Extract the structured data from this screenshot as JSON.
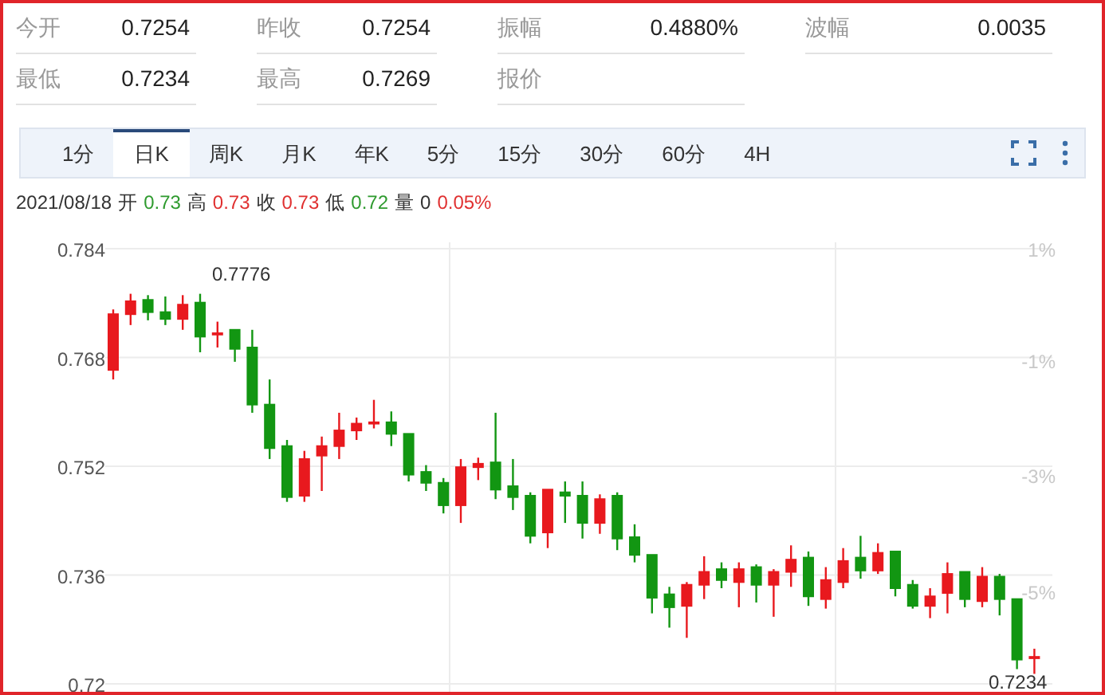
{
  "stats": [
    {
      "label": "今开",
      "value": "0.7254"
    },
    {
      "label": "昨收",
      "value": "0.7254"
    },
    {
      "label": "振幅",
      "value": "0.4880%"
    },
    {
      "label": "波幅",
      "value": "0.0035"
    },
    {
      "label": "最低",
      "value": "0.7234"
    },
    {
      "label": "最高",
      "value": "0.7269"
    },
    {
      "label": "报价"
    }
  ],
  "tabs": [
    {
      "label": "1分",
      "selected": false
    },
    {
      "label": "日K",
      "selected": true
    },
    {
      "label": "周K",
      "selected": false
    },
    {
      "label": "月K",
      "selected": false
    },
    {
      "label": "年K",
      "selected": false
    },
    {
      "label": "5分",
      "selected": false
    },
    {
      "label": "15分",
      "selected": false
    },
    {
      "label": "30分",
      "selected": false
    },
    {
      "label": "60分",
      "selected": false
    },
    {
      "label": "4H",
      "selected": false
    }
  ],
  "info": {
    "date": "2021/08/18",
    "items": [
      {
        "label": "开",
        "value": "0.73",
        "color": "#2e9a2e"
      },
      {
        "label": "高",
        "value": "0.73",
        "color": "#e03030"
      },
      {
        "label": "收",
        "value": "0.73",
        "color": "#e03030"
      },
      {
        "label": "低",
        "value": "0.72",
        "color": "#2e9a2e"
      },
      {
        "label": "量",
        "value": "0",
        "color": "#333333"
      }
    ],
    "change": "0.05%"
  },
  "chart": {
    "percent_labels": [
      "1%",
      "-1%",
      "-3%",
      "-5%"
    ],
    "high_label": "0.7776",
    "low_label": "0.7234",
    "chart_data": {
      "type": "candlestick",
      "grid": true,
      "ylim": [
        0.72,
        0.784
      ],
      "yticks": [
        0.784,
        0.768,
        0.752,
        0.736,
        0.72
      ],
      "ohlc": [
        [
          0.7664,
          0.7753,
          0.765,
          0.7746
        ],
        [
          0.7746,
          0.7776,
          0.773,
          0.7765
        ],
        [
          0.7767,
          0.7774,
          0.7737,
          0.7749
        ],
        [
          0.7749,
          0.7772,
          0.773,
          0.7739
        ],
        [
          0.7739,
          0.7774,
          0.7723,
          0.776
        ],
        [
          0.7763,
          0.7776,
          0.769,
          0.7713
        ],
        [
          0.7716,
          0.7735,
          0.7697,
          0.7718
        ],
        [
          0.7723,
          0.7723,
          0.7676,
          0.7695
        ],
        [
          0.7697,
          0.7723,
          0.7601,
          0.7613
        ],
        [
          0.7613,
          0.765,
          0.7533,
          0.7549
        ],
        [
          0.7552,
          0.7561,
          0.747,
          0.7477
        ],
        [
          0.7479,
          0.7545,
          0.747,
          0.7533
        ],
        [
          0.7538,
          0.7566,
          0.7486,
          0.7552
        ],
        [
          0.7552,
          0.7601,
          0.7533,
          0.7575
        ],
        [
          0.7575,
          0.7594,
          0.7561,
          0.7585
        ],
        [
          0.7585,
          0.762,
          0.7578,
          0.7587
        ],
        [
          0.7587,
          0.7603,
          0.7552,
          0.757
        ],
        [
          0.757,
          0.757,
          0.75,
          0.751
        ],
        [
          0.7514,
          0.7524,
          0.7486,
          0.7498
        ],
        [
          0.7498,
          0.7505,
          0.7453,
          0.7465
        ],
        [
          0.7465,
          0.7533,
          0.7439,
          0.7521
        ],
        [
          0.7521,
          0.7535,
          0.7502,
          0.7526
        ],
        [
          0.7528,
          0.7601,
          0.7474,
          0.7488
        ],
        [
          0.7493,
          0.7533,
          0.7458,
          0.7477
        ],
        [
          0.7479,
          0.7484,
          0.7409,
          0.742
        ],
        [
          0.7425,
          0.7488,
          0.7402,
          0.7488
        ],
        [
          0.7484,
          0.75,
          0.7439,
          0.7479
        ],
        [
          0.7479,
          0.75,
          0.7416,
          0.7439
        ],
        [
          0.7439,
          0.7481,
          0.7423,
          0.7474
        ],
        [
          0.7479,
          0.7484,
          0.7399,
          0.7416
        ],
        [
          0.7418,
          0.7437,
          0.7381,
          0.7392
        ],
        [
          0.7392,
          0.7392,
          0.7306,
          0.7329
        ],
        [
          0.7334,
          0.7345,
          0.7285,
          0.7315
        ],
        [
          0.7317,
          0.7352,
          0.727,
          0.7348
        ],
        [
          0.7348,
          0.739,
          0.7327,
          0.7367
        ],
        [
          0.7371,
          0.7381,
          0.7343,
          0.7355
        ],
        [
          0.7352,
          0.7381,
          0.7315,
          0.7371
        ],
        [
          0.7374,
          0.7378,
          0.7322,
          0.7348
        ],
        [
          0.7348,
          0.7371,
          0.7301,
          0.7367
        ],
        [
          0.7367,
          0.7406,
          0.7345,
          0.7385
        ],
        [
          0.7388,
          0.7397,
          0.7317,
          0.7331
        ],
        [
          0.7327,
          0.7374,
          0.7313,
          0.7355
        ],
        [
          0.7352,
          0.7402,
          0.7343,
          0.7383
        ],
        [
          0.7388,
          0.742,
          0.7357,
          0.7369
        ],
        [
          0.7369,
          0.7409,
          0.7364,
          0.7395
        ],
        [
          0.7397,
          0.7397,
          0.7331,
          0.7343
        ],
        [
          0.7348,
          0.7355,
          0.7313,
          0.7317
        ],
        [
          0.7317,
          0.7343,
          0.7299,
          0.7331
        ],
        [
          0.7336,
          0.7381,
          0.7306,
          0.7364
        ],
        [
          0.7367,
          0.7367,
          0.7315,
          0.7327
        ],
        [
          0.7324,
          0.7374,
          0.7315,
          0.736
        ],
        [
          0.736,
          0.7364,
          0.7303,
          0.7327
        ],
        [
          0.7327,
          0.7327,
          0.7224,
          0.7238
        ],
        [
          0.724,
          0.7254,
          0.7217,
          0.7242
        ]
      ]
    }
  }
}
